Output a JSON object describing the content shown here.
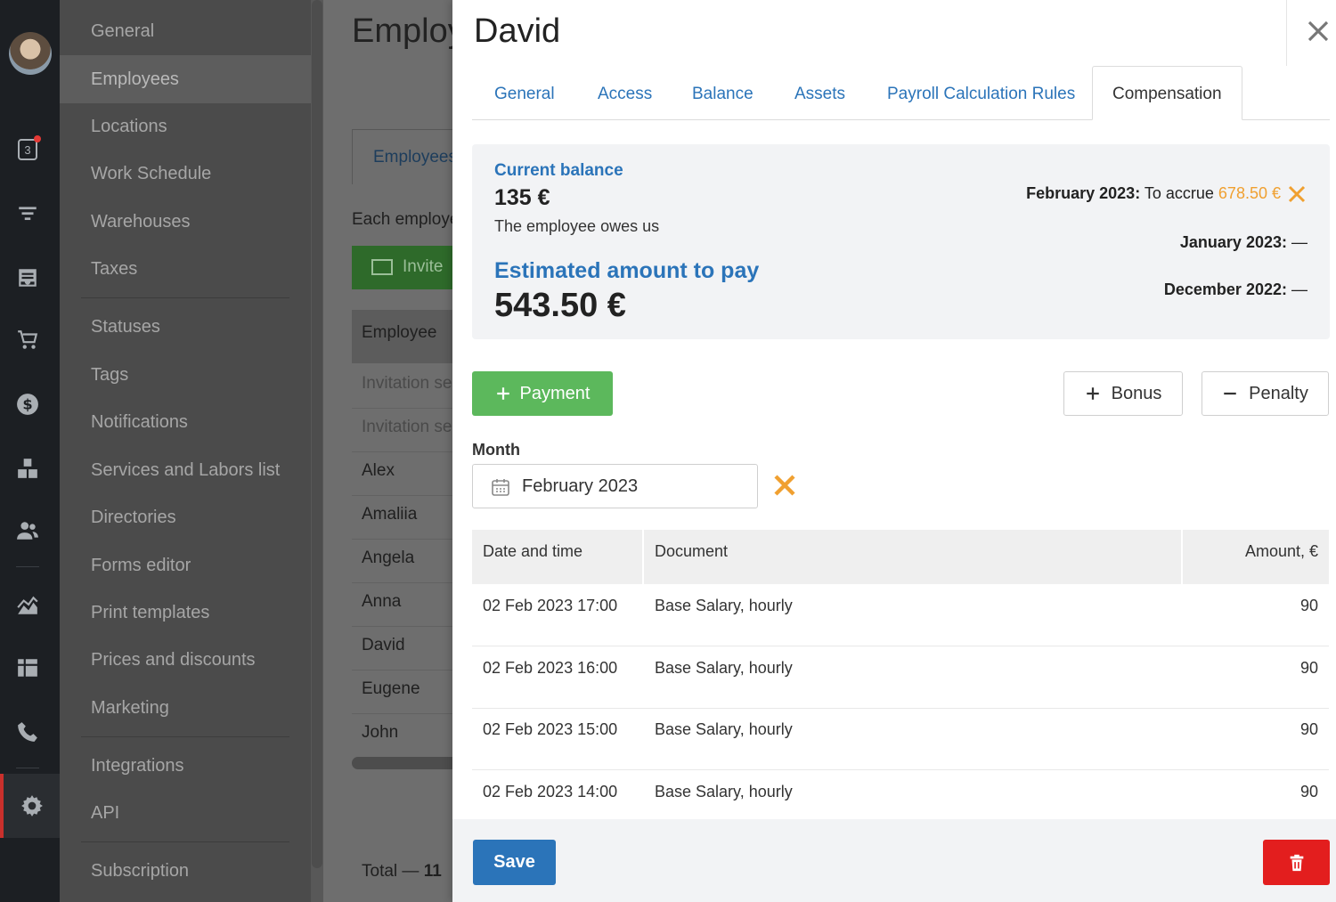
{
  "iconbar": {
    "badge_count": "3",
    "icons": [
      "calendar-icon",
      "filter-icon",
      "inbox-icon",
      "cart-icon",
      "dollar-icon",
      "boxes-icon",
      "users-icon",
      "chart-icon",
      "dashboard-icon",
      "phone-icon",
      "gear-icon"
    ]
  },
  "settings_menu": {
    "items": [
      "General",
      "Employees",
      "Locations",
      "Work Schedule",
      "Warehouses",
      "Taxes",
      "Statuses",
      "Tags",
      "Notifications",
      "Services and Labors list",
      "Directories",
      "Forms editor",
      "Print templates",
      "Prices and discounts",
      "Marketing",
      "Integrations",
      "API",
      "Subscription"
    ],
    "active": "Employees"
  },
  "background_page": {
    "title": "Employees",
    "tab": "Employees",
    "text": "Each employee",
    "invite_label": "Invite",
    "column_header": "Employee",
    "rows": [
      "Invitation sent",
      "Invitation sent",
      "Alex",
      "Amaliia",
      "Angela",
      "Anna",
      "David",
      "Eugene",
      "John"
    ],
    "total_label": "Total — ",
    "total_value": "11"
  },
  "panel": {
    "title": "David",
    "tabs": [
      "General",
      "Access",
      "Balance",
      "Assets",
      "Payroll Calculation Rules",
      "Compensation"
    ],
    "active_tab": "Compensation",
    "current_balance_label": "Current balance",
    "current_balance_value": "135 €",
    "balance_note": "The employee owes us",
    "estimated_label": "Estimated amount to pay",
    "estimated_value": "543.50 €",
    "months": [
      {
        "label": "February 2023:",
        "text": " To accrue ",
        "amount": "678.50 €"
      },
      {
        "label": "January 2023:",
        "text": " —"
      },
      {
        "label": "December 2022:",
        "text": " —"
      }
    ],
    "payment_label": "Payment",
    "bonus_label": "Bonus",
    "penalty_label": "Penalty",
    "month_label": "Month",
    "month_value": "February 2023",
    "table": {
      "headers": [
        "Date and time",
        "Document",
        "Amount, €"
      ],
      "rows": [
        [
          "02 Feb 2023 17:00",
          "Base Salary, hourly",
          "90"
        ],
        [
          "02 Feb 2023 16:00",
          "Base Salary, hourly",
          "90"
        ],
        [
          "02 Feb 2023 15:00",
          "Base Salary, hourly",
          "90"
        ],
        [
          "02 Feb 2023 14:00",
          "Base Salary, hourly",
          "90"
        ]
      ]
    },
    "save_label": "Save"
  },
  "colors": {
    "accent_blue": "#2b74b9",
    "payment_green": "#5cb85c",
    "warning_orange": "#f0a030",
    "delete_red": "#e31e1e"
  }
}
